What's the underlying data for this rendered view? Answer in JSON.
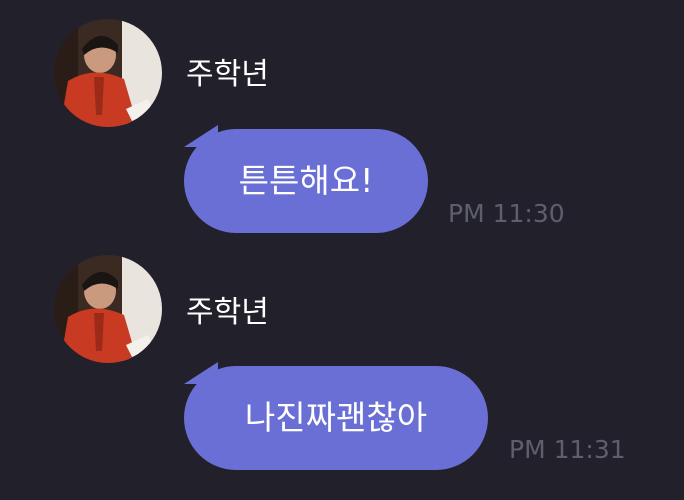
{
  "messages": [
    {
      "sender": "주학년",
      "text": "튼튼해요!",
      "time": "PM 11:30",
      "avatar_icon": "profile-photo-icon"
    },
    {
      "sender": "주학년",
      "text": "나진짜괜찮아",
      "time": "PM 11:31",
      "avatar_icon": "profile-photo-icon"
    }
  ],
  "colors": {
    "background": "#22212b",
    "bubble": "#6a6fd6",
    "timestamp": "#5d5f6b",
    "text": "#ffffff"
  }
}
